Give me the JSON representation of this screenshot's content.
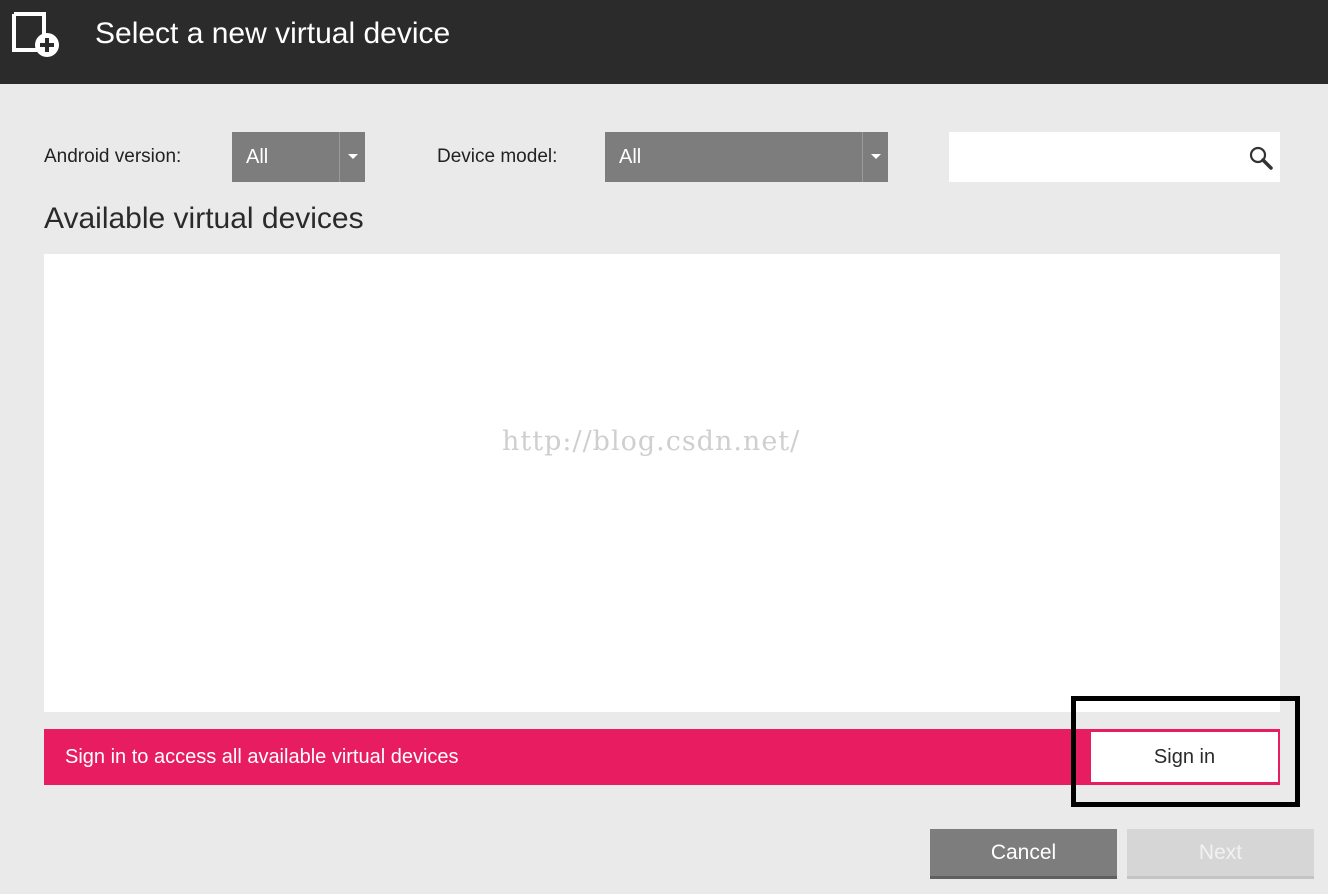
{
  "window": {
    "title": "Select a new virtual device",
    "icon": "add-device-icon"
  },
  "filters": {
    "android_version": {
      "label": "Android version:",
      "value": "All"
    },
    "device_model": {
      "label": "Device model:",
      "value": "All"
    },
    "search": {
      "value": "",
      "icon": "search-icon"
    }
  },
  "devices": {
    "heading": "Available virtual devices",
    "items": [],
    "watermark": "http://blog.csdn.net/"
  },
  "signin_banner": {
    "message": "Sign in to access all available virtual devices",
    "button_label": "Sign in",
    "accent_color": "#e81d61"
  },
  "actions": {
    "cancel_label": "Cancel",
    "next_label": "Next"
  },
  "colors": {
    "titlebar": "#2b2b2b",
    "background": "#eaeaea",
    "select": "#7d7d7d"
  }
}
